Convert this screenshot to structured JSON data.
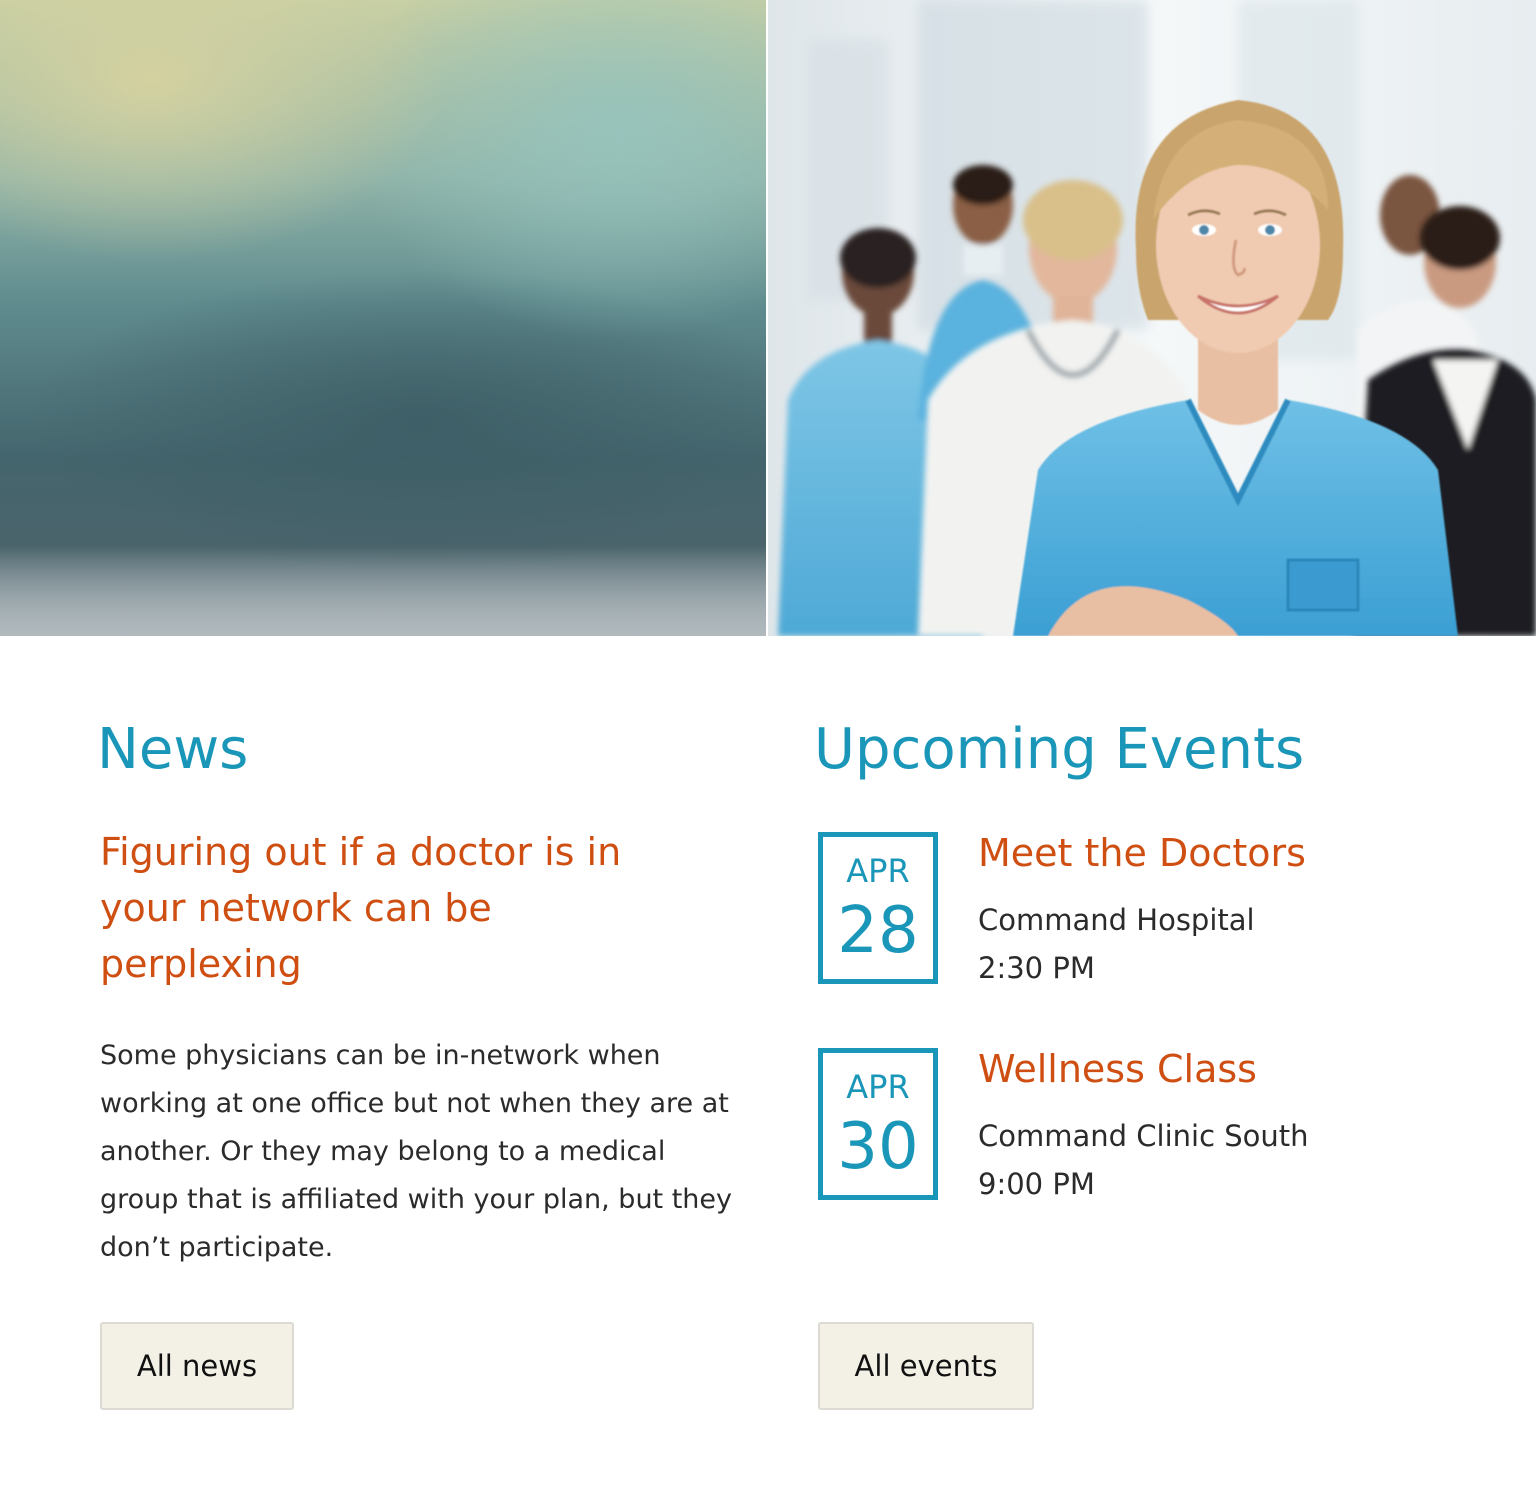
{
  "hero": {
    "left_image": "blurred-gradient-background",
    "right_image": "medical-team-photo"
  },
  "news": {
    "title": "News",
    "headline": "Figuring out if a doctor is in your network can be perplexing",
    "body": "Some physicians can be in-network when working at one office but not when they are at another. Or they may belong to a medical group that is affiliated with your plan, but they don’t participate.",
    "button_label": "All news"
  },
  "events": {
    "title": "Upcoming Events",
    "items": [
      {
        "month": "APR",
        "day": "28",
        "title": "Meet the Doctors",
        "place": "Command Hospital",
        "time": "2:30 PM"
      },
      {
        "month": "APR",
        "day": "30",
        "title": "Wellness Class",
        "place": "Command Clinic South",
        "time": "9:00 PM"
      }
    ],
    "button_label": "All events"
  },
  "colors": {
    "accent_blue": "#1a96b8",
    "accent_orange": "#cf4f12",
    "button_bg": "#f3f0e6",
    "text": "#2b2b2b"
  }
}
